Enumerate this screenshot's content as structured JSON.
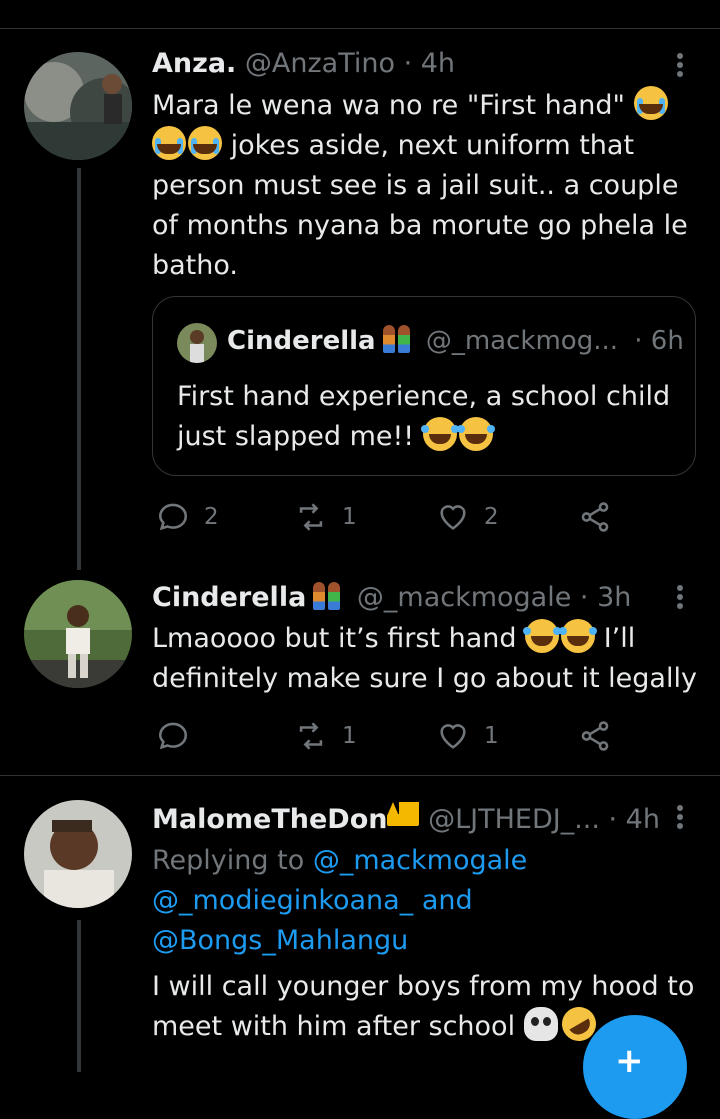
{
  "tweets": [
    {
      "name": "Anza.",
      "handle": "@AnzaTino · 4h",
      "text_a": "Mara le wena wa no re \"First hand\" ",
      "text_b": " jokes aside, next uniform that person must see is a jail suit.. a couple of months nyana ba morute go phela le batho.",
      "quote": {
        "name": "Cinderella",
        "handle": "@_mackmog...",
        "time": "· 6h",
        "text": "First hand experience, a school child just slapped me!! "
      },
      "actions": {
        "replies": "2",
        "retweets": "1",
        "likes": "2"
      }
    },
    {
      "name": "Cinderella",
      "handle": "@_mackmogale · 3h",
      "text_a": "Lmaoooo but it’s first hand ",
      "text_b": " I’ll definitely make sure I go about it legally",
      "actions": {
        "replies": "",
        "retweets": "1",
        "likes": "1"
      }
    },
    {
      "name": "MalomeTheDon",
      "handle": "@LJTHEDJ_... · 4h",
      "replying_prefix": "Replying to ",
      "replying_1": "@_mackmogale",
      "replying_2": "@_modieginkoana_",
      "replying_and": " and",
      "replying_3": "@Bongs_Mahlangu",
      "text_a": "I will call younger boys from my hood to meet with him after school "
    }
  ],
  "fab": {
    "glyph": "+"
  },
  "colors": {
    "accent": "#1d9bf0",
    "muted": "#71767b",
    "background": "#000000"
  }
}
